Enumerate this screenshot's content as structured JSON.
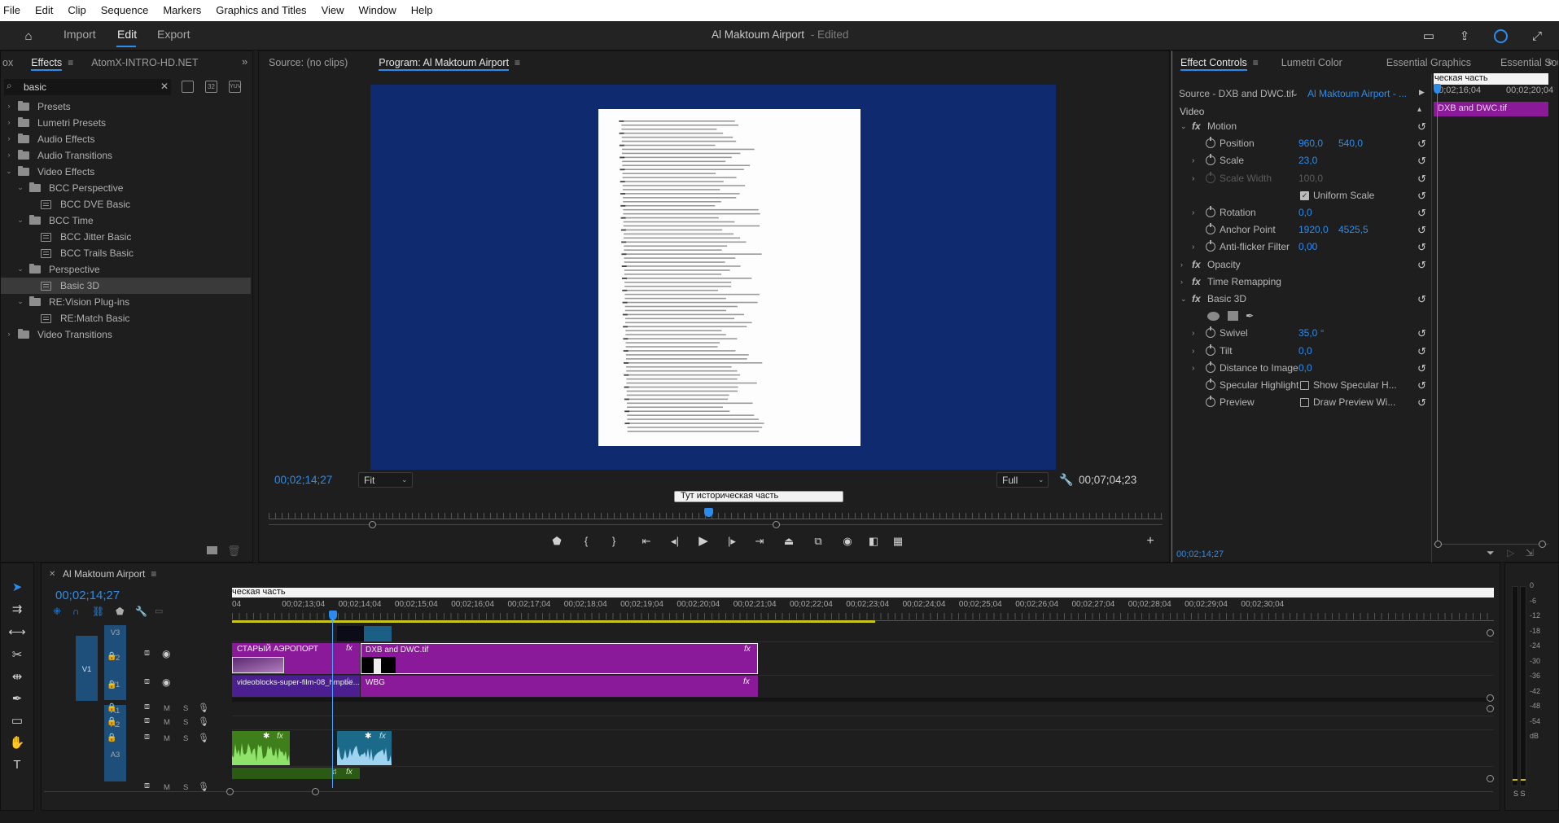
{
  "menu": [
    "File",
    "Edit",
    "Clip",
    "Sequence",
    "Markers",
    "Graphics and Titles",
    "View",
    "Window",
    "Help"
  ],
  "header": {
    "nav": [
      "Import",
      "Edit",
      "Export"
    ],
    "active_nav": "Edit",
    "project_title": "Al Maktoum Airport",
    "edited_label": "- Edited"
  },
  "effects_panel": {
    "tabs": [
      "ox",
      "Effects",
      "AtomX-INTRO-HD.NET"
    ],
    "search_value": "basic",
    "tree": [
      {
        "label": "Presets",
        "kind": "folder",
        "level": 0,
        "state": "collapsed"
      },
      {
        "label": "Lumetri Presets",
        "kind": "folder",
        "level": 0,
        "state": "collapsed"
      },
      {
        "label": "Audio Effects",
        "kind": "folder",
        "level": 0,
        "state": "collapsed"
      },
      {
        "label": "Audio Transitions",
        "kind": "folder",
        "level": 0,
        "state": "collapsed"
      },
      {
        "label": "Video Effects",
        "kind": "folder",
        "level": 0,
        "state": "expanded"
      },
      {
        "label": "BCC Perspective",
        "kind": "folder",
        "level": 1,
        "state": "expanded"
      },
      {
        "label": "BCC DVE Basic",
        "kind": "effect",
        "level": 2,
        "state": ""
      },
      {
        "label": "BCC Time",
        "kind": "folder",
        "level": 1,
        "state": "expanded"
      },
      {
        "label": "BCC Jitter Basic",
        "kind": "effect",
        "level": 2,
        "state": ""
      },
      {
        "label": "BCC Trails Basic",
        "kind": "effect",
        "level": 2,
        "state": ""
      },
      {
        "label": "Perspective",
        "kind": "folder",
        "level": 1,
        "state": "expanded"
      },
      {
        "label": "Basic 3D",
        "kind": "effect",
        "level": 2,
        "state": "selected"
      },
      {
        "label": "RE:Vision Plug-ins",
        "kind": "folder",
        "level": 1,
        "state": "expanded"
      },
      {
        "label": "RE:Match Basic",
        "kind": "effect",
        "level": 2,
        "state": ""
      },
      {
        "label": "Video Transitions",
        "kind": "folder",
        "level": 0,
        "state": "collapsed"
      }
    ]
  },
  "monitor": {
    "source_tab": "Source: (no clips)",
    "program_tab": "Program: Al Maktoum Airport",
    "current_tc": "00;02;14;27",
    "fit": "Fit",
    "quality": "Full",
    "duration_tc": "00;07;04;23",
    "marker_text": "Тут историческая часть"
  },
  "effect_controls": {
    "tabs": [
      "Effect Controls",
      "Lumetri Color",
      "Essential Graphics",
      "Essential Sou"
    ],
    "source_label": "Source - DXB and DWC.tif",
    "sequence_label": "Al Maktoum Airport - ...",
    "mini_tc_left": "00;02;16;04",
    "mini_tc_right": "00;02;20;04",
    "mini_marker": "ческая часть",
    "mini_clip": "DXB and DWC.tif",
    "section_video": "Video",
    "footer_tc": "00;02;14;27",
    "rows": {
      "motion": "Motion",
      "position": {
        "label": "Position",
        "v1": "960,0",
        "v2": "540,0"
      },
      "scale": {
        "label": "Scale",
        "v1": "23,0"
      },
      "scale_width": {
        "label": "Scale Width",
        "v1": "100,0"
      },
      "uniform": "Uniform Scale",
      "rotation": {
        "label": "Rotation",
        "v1": "0,0"
      },
      "anchor": {
        "label": "Anchor Point",
        "v1": "1920,0",
        "v2": "4525,5"
      },
      "antiflicker": {
        "label": "Anti-flicker Filter",
        "v1": "0,00"
      },
      "opacity": "Opacity",
      "timeremap": "Time Remapping",
      "basic3d": "Basic 3D",
      "swivel": {
        "label": "Swivel",
        "v1": "35,0 °"
      },
      "tilt": {
        "label": "Tilt",
        "v1": "0,0"
      },
      "distance": {
        "label": "Distance to Image",
        "v1": "0,0"
      },
      "specular": {
        "label": "Specular Highlight",
        "check": "Show Specular H..."
      },
      "preview": {
        "label": "Preview",
        "check": "Draw Preview Wi..."
      }
    }
  },
  "timeline": {
    "sequence_name": "Al Maktoum Airport",
    "current_tc": "00;02;14;27",
    "marker_text": "ческая часть",
    "ruler": [
      "04",
      "00;02;13;04",
      "00;02;14;04",
      "00;02;15;04",
      "00;02;16;04",
      "00;02;17;04",
      "00;02;18;04",
      "00;02;19;04",
      "00;02;20;04",
      "00;02;21;04",
      "00;02;22;04",
      "00;02;23;04",
      "00;02;24;04",
      "00;02;25;04",
      "00;02;26;04",
      "00;02;27;04",
      "00;02;28;04",
      "00;02;29;04",
      "00;02;30;04"
    ],
    "tracks": {
      "v3": "V3",
      "v2": "V2",
      "v1": "V1",
      "v1src": "V1",
      "a1": "A1",
      "a2": "A2",
      "a3": "A3",
      "m": "M",
      "s": "S"
    },
    "clips": {
      "v2_a": "СТАРЫЙ АЭРОПОРТ",
      "v2_b": "DXB and DWC.tif",
      "v1_a": "videoblocks-super-film-08_hmpbe...",
      "v1_b": "WBG",
      "fx": "fx"
    },
    "meter_labels": [
      "0",
      "-6",
      "-12",
      "-18",
      "-24",
      "-30",
      "-36",
      "-42",
      "-48",
      "-54",
      "dB"
    ],
    "meter_solo": "S S"
  },
  "colors": {
    "accent": "#2d8ceb",
    "clip_purple": "#8b1a9a",
    "clip_violet": "#4b1f8f",
    "audio_green": "#3a7a1a",
    "audio_teal": "#1b6a8a",
    "program_bg": "#0f2a6e"
  }
}
